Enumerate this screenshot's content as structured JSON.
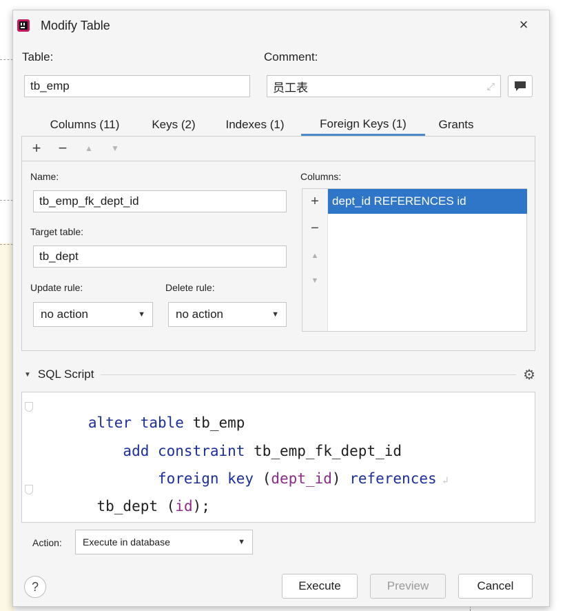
{
  "dialog": {
    "title": "Modify Table",
    "close_glyph": "×"
  },
  "table": {
    "label": "Table:",
    "value": "tb_emp"
  },
  "comment": {
    "label": "Comment:",
    "value": "员工表",
    "expand_glyph": "⤢"
  },
  "tabs": [
    {
      "label": "Columns (11)"
    },
    {
      "label": "Keys (2)"
    },
    {
      "label": "Indexes (1)"
    },
    {
      "label": "Foreign Keys (1)",
      "active": true
    },
    {
      "label": "Grants"
    }
  ],
  "toolbar": {
    "add": "+",
    "remove": "−",
    "up": "▲",
    "down": "▼"
  },
  "fk": {
    "name_label": "Name:",
    "name_value": "tb_emp_fk_dept_id",
    "target_label": "Target table:",
    "target_value": "tb_dept",
    "update_label": "Update rule:",
    "update_value": "no action",
    "delete_label": "Delete rule:",
    "delete_value": "no action",
    "columns_label": "Columns:",
    "columns_items": [
      "dept_id REFERENCES id"
    ]
  },
  "sql": {
    "header": "SQL Script",
    "lines": [
      [
        {
          "t": "alter table ",
          "c": "kw"
        },
        {
          "t": "tb_emp",
          "c": "id"
        }
      ],
      [
        {
          "t": "    add constraint ",
          "c": "kw"
        },
        {
          "t": "tb_emp_fk_dept_id",
          "c": "id"
        }
      ],
      [
        {
          "t": "        foreign key ",
          "c": "kw"
        },
        {
          "t": "(",
          "c": "id"
        },
        {
          "t": "dept_id",
          "c": "col"
        },
        {
          "t": ") ",
          "c": "id"
        },
        {
          "t": "references",
          "c": "kw"
        }
      ],
      [
        {
          "t": " tb_dept (",
          "c": "id"
        },
        {
          "t": "id",
          "c": "col"
        },
        {
          "t": ");",
          "c": "id"
        }
      ]
    ]
  },
  "action": {
    "label": "Action:",
    "value": "Execute in database"
  },
  "buttons": {
    "help": "?",
    "execute": "Execute",
    "preview": "Preview",
    "cancel": "Cancel"
  },
  "colors": {
    "accent": "#2f75c8",
    "keyword": "#1b2f9c",
    "column_ref": "#8a2b8a"
  },
  "icons": [
    "app-icon",
    "close-icon",
    "expand-icon",
    "comment-editor-icon",
    "gear-icon",
    "chevron-down-icon",
    "help-icon"
  ]
}
